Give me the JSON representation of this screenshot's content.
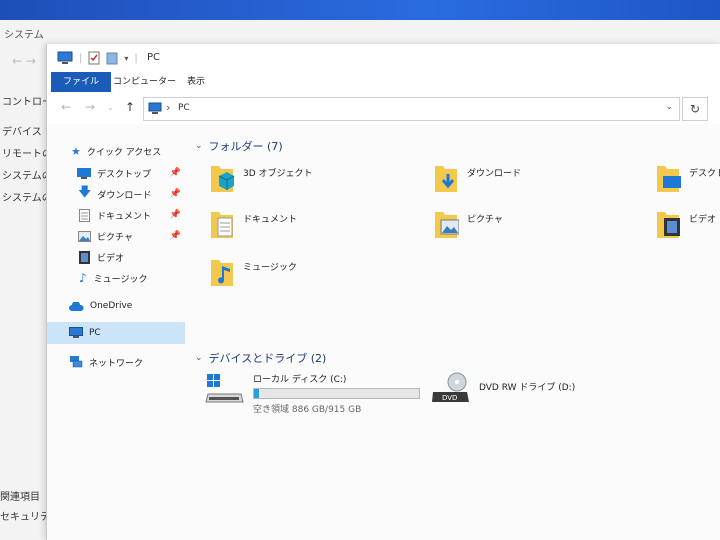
{
  "background_window": {
    "title": "システム",
    "left_items": [
      "コントロール",
      "デバイス マネ",
      "リモートの設",
      "システムの保",
      "システムの詳"
    ],
    "bottom_items": [
      "関連項目",
      "セキュリティ"
    ]
  },
  "window": {
    "title": "PC",
    "ribbon_tabs": [
      "ファイル",
      "コンピューター",
      "表示"
    ]
  },
  "address": {
    "path": "PC",
    "separator": "›"
  },
  "nav": {
    "quick_access": "クイック アクセス",
    "quick_items": [
      {
        "label": "デスクトップ",
        "pinned": true
      },
      {
        "label": "ダウンロード",
        "pinned": true
      },
      {
        "label": "ドキュメント",
        "pinned": true
      },
      {
        "label": "ピクチャ",
        "pinned": true
      },
      {
        "label": "ビデオ",
        "pinned": false
      },
      {
        "label": "ミュージック",
        "pinned": false
      }
    ],
    "onedrive": "OneDrive",
    "pc": "PC",
    "network": "ネットワーク"
  },
  "folders": {
    "header": "フォルダー (7)",
    "items": [
      "3D オブジェクト",
      "ダウンロード",
      "デスクトップ",
      "ドキュメント",
      "ピクチャ",
      "ビデオ",
      "ミュージック"
    ]
  },
  "drives": {
    "header": "デバイスとドライブ (2)",
    "local": {
      "name": "ローカル ディスク (C:)",
      "free": "空き領域 886 GB/915 GB",
      "used_fraction": 0.032
    },
    "dvd": {
      "name": "DVD RW ドライブ (D:)",
      "badge": "DVD"
    }
  },
  "colors": {
    "accent": "#1b5cb8",
    "folder": "#f2c94c",
    "selection": "#cce4f7",
    "drive_bar": "#26a0da"
  }
}
